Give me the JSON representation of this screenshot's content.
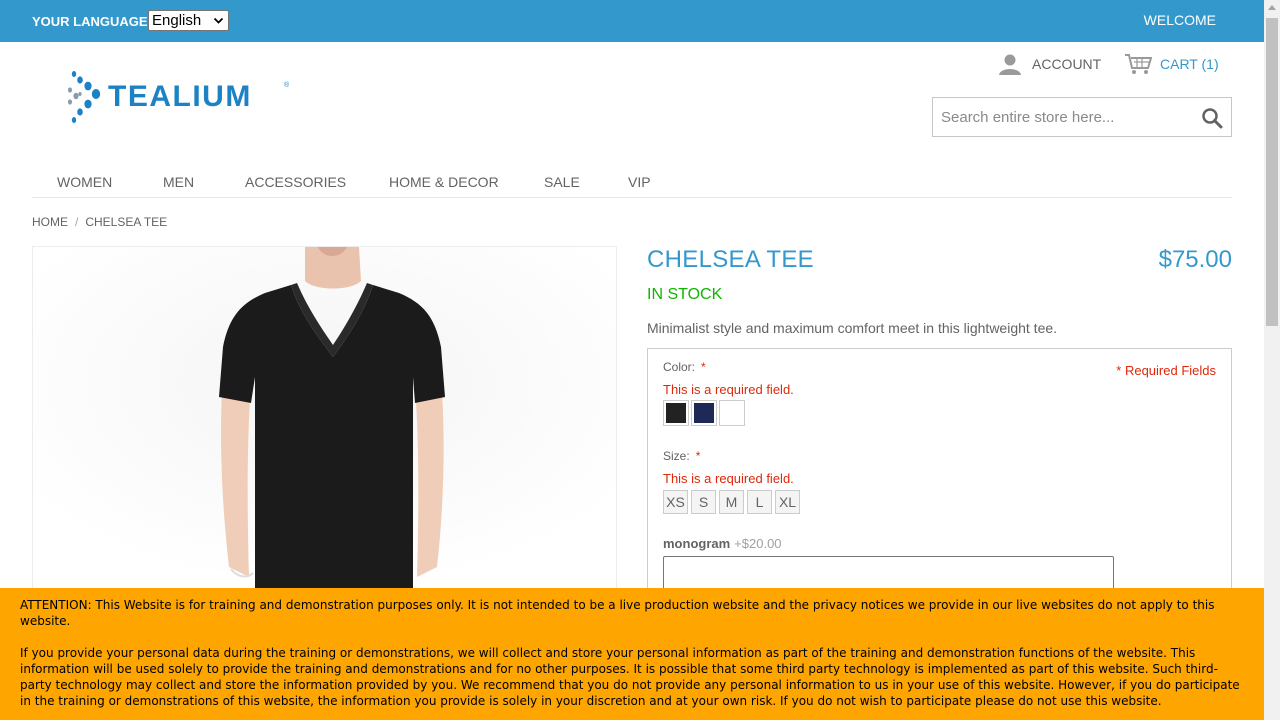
{
  "header": {
    "language_label": "YOUR LANGUAGE:",
    "language_selected": "English",
    "welcome": "WELCOME",
    "account_label": "ACCOUNT",
    "cart_label": "CART",
    "cart_count": "(1)"
  },
  "logo": {
    "text": "TEALIUM",
    "mark": "®"
  },
  "search": {
    "placeholder": "Search entire store here..."
  },
  "nav": {
    "items": [
      "WOMEN",
      "MEN",
      "ACCESSORIES",
      "HOME & DECOR",
      "SALE",
      "VIP"
    ]
  },
  "breadcrumb": {
    "home": "HOME",
    "separator": "/",
    "current": "CHELSEA TEE"
  },
  "product": {
    "name": "CHELSEA TEE",
    "price": "$75.00",
    "stock": "IN STOCK",
    "description": "Minimalist style and maximum comfort meet in this lightweight tee.",
    "required_fields": "* Required Fields",
    "color_label": "Color:",
    "size_label": "Size:",
    "required_star": "*",
    "error_text": "This is a required field.",
    "colors": [
      "#222222",
      "#1e2a55",
      "#ffffff"
    ],
    "sizes": [
      "XS",
      "S",
      "M",
      "L",
      "XL"
    ],
    "monogram_label": "monogram",
    "monogram_price": "+$20.00"
  },
  "notice": {
    "para1": "ATTENTION: This Website is for training and demonstration purposes only. It is not intended to be a live production website and the privacy notices we provide in our live websites do not apply to this website.",
    "para2": "If you provide your personal data during the training or demonstrations, we will collect and store your personal information as part of the training and demonstration functions of the website. This information will be used solely to provide the training and demonstrations and for no other purposes. It is possible that some third party technology is implemented as part of this website. Such third-party technology may collect and store the information provided by you. We recommend that you do not provide any personal information to us in your use of this website. However, if you do participate in the training or demonstrations of this website, the information you provide is solely in your discretion and at your own risk. If you do not wish to participate please do not use this website."
  },
  "colors": {
    "brand": "#3399cc",
    "error": "#df280a",
    "stock": "#11b400",
    "notice_bg": "#ffa500"
  },
  "icons": [
    "chevron-down-icon",
    "user-icon",
    "cart-icon",
    "search-icon",
    "tealium-logo-icon",
    "scroll-up-arrow-icon"
  ]
}
